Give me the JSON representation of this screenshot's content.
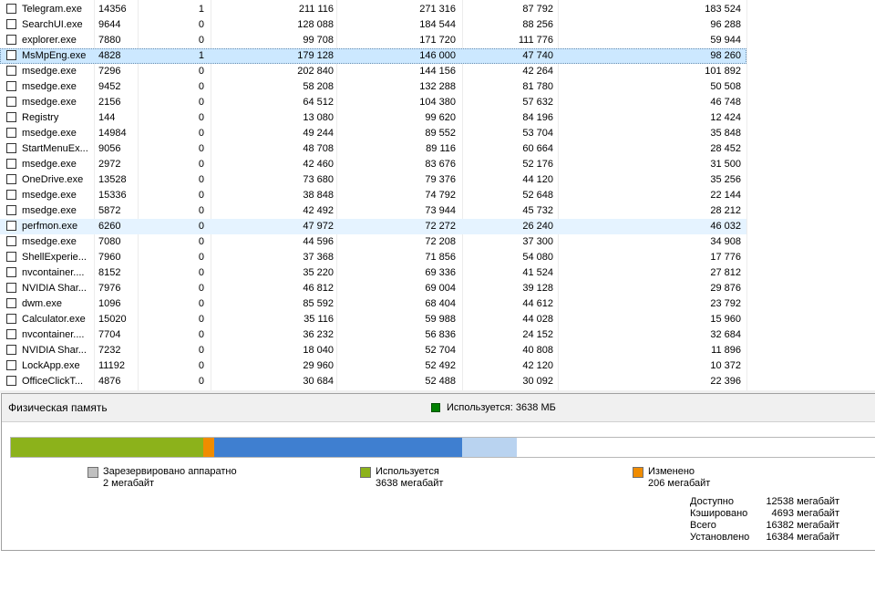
{
  "processes": [
    {
      "name": "Telegram.exe",
      "pid": "14356",
      "a": "1",
      "b": "211 116",
      "c": "271 316",
      "d": "87 792",
      "e": "183 524"
    },
    {
      "name": "SearchUI.exe",
      "pid": "9644",
      "a": "0",
      "b": "128 088",
      "c": "184 544",
      "d": "88 256",
      "e": "96 288"
    },
    {
      "name": "explorer.exe",
      "pid": "7880",
      "a": "0",
      "b": "99 708",
      "c": "171 720",
      "d": "111 776",
      "e": "59 944"
    },
    {
      "name": "MsMpEng.exe",
      "pid": "4828",
      "a": "1",
      "b": "179 128",
      "c": "146 000",
      "d": "47 740",
      "e": "98 260",
      "state": "selected"
    },
    {
      "name": "msedge.exe",
      "pid": "7296",
      "a": "0",
      "b": "202 840",
      "c": "144 156",
      "d": "42 264",
      "e": "101 892"
    },
    {
      "name": "msedge.exe",
      "pid": "9452",
      "a": "0",
      "b": "58 208",
      "c": "132 288",
      "d": "81 780",
      "e": "50 508"
    },
    {
      "name": "msedge.exe",
      "pid": "2156",
      "a": "0",
      "b": "64 512",
      "c": "104 380",
      "d": "57 632",
      "e": "46 748"
    },
    {
      "name": "Registry",
      "pid": "144",
      "a": "0",
      "b": "13 080",
      "c": "99 620",
      "d": "84 196",
      "e": "12 424"
    },
    {
      "name": "msedge.exe",
      "pid": "14984",
      "a": "0",
      "b": "49 244",
      "c": "89 552",
      "d": "53 704",
      "e": "35 848"
    },
    {
      "name": "StartMenuEx...",
      "pid": "9056",
      "a": "0",
      "b": "48 708",
      "c": "89 116",
      "d": "60 664",
      "e": "28 452"
    },
    {
      "name": "msedge.exe",
      "pid": "2972",
      "a": "0",
      "b": "42 460",
      "c": "83 676",
      "d": "52 176",
      "e": "31 500"
    },
    {
      "name": "OneDrive.exe",
      "pid": "13528",
      "a": "0",
      "b": "73 680",
      "c": "79 376",
      "d": "44 120",
      "e": "35 256"
    },
    {
      "name": "msedge.exe",
      "pid": "15336",
      "a": "0",
      "b": "38 848",
      "c": "74 792",
      "d": "52 648",
      "e": "22 144"
    },
    {
      "name": "msedge.exe",
      "pid": "5872",
      "a": "0",
      "b": "42 492",
      "c": "73 944",
      "d": "45 732",
      "e": "28 212"
    },
    {
      "name": "perfmon.exe",
      "pid": "6260",
      "a": "0",
      "b": "47 972",
      "c": "72 272",
      "d": "26 240",
      "e": "46 032",
      "state": "hover"
    },
    {
      "name": "msedge.exe",
      "pid": "7080",
      "a": "0",
      "b": "44 596",
      "c": "72 208",
      "d": "37 300",
      "e": "34 908"
    },
    {
      "name": "ShellExperie...",
      "pid": "7960",
      "a": "0",
      "b": "37 368",
      "c": "71 856",
      "d": "54 080",
      "e": "17 776"
    },
    {
      "name": "nvcontainer....",
      "pid": "8152",
      "a": "0",
      "b": "35 220",
      "c": "69 336",
      "d": "41 524",
      "e": "27 812"
    },
    {
      "name": "NVIDIA Shar...",
      "pid": "7976",
      "a": "0",
      "b": "46 812",
      "c": "69 004",
      "d": "39 128",
      "e": "29 876"
    },
    {
      "name": "dwm.exe",
      "pid": "1096",
      "a": "0",
      "b": "85 592",
      "c": "68 404",
      "d": "44 612",
      "e": "23 792"
    },
    {
      "name": "Calculator.exe",
      "pid": "15020",
      "a": "0",
      "b": "35 116",
      "c": "59 988",
      "d": "44 028",
      "e": "15 960"
    },
    {
      "name": "nvcontainer....",
      "pid": "7704",
      "a": "0",
      "b": "36 232",
      "c": "56 836",
      "d": "24 152",
      "e": "32 684"
    },
    {
      "name": "NVIDIA Shar...",
      "pid": "7232",
      "a": "0",
      "b": "18 040",
      "c": "52 704",
      "d": "40 808",
      "e": "11 896"
    },
    {
      "name": "LockApp.exe",
      "pid": "11192",
      "a": "0",
      "b": "29 960",
      "c": "52 492",
      "d": "42 120",
      "e": "10 372"
    },
    {
      "name": "OfficeClickT...",
      "pid": "4876",
      "a": "0",
      "b": "30 684",
      "c": "52 488",
      "d": "30 092",
      "e": "22 396"
    }
  ],
  "memory": {
    "title": "Физическая память",
    "summary": "Используется: 3638 МБ",
    "bar_total_mb": 16384,
    "bar_segments": [
      {
        "key": "used",
        "mb": 3638,
        "color": "#8cb21b"
      },
      {
        "key": "modified",
        "mb": 206,
        "color": "#f08c00"
      },
      {
        "key": "standby",
        "mb": 4693,
        "color": "#3f7fd0"
      },
      {
        "key": "free",
        "mb": 1030,
        "color": "#b9d3f0"
      }
    ],
    "legend": {
      "reserved": {
        "label": "Зарезервировано аппаратно",
        "value": "2 мегабайт",
        "color": "#c0c0c0"
      },
      "used": {
        "label": "Используется",
        "value": "3638 мегабайт",
        "color": "#8cb21b"
      },
      "modified": {
        "label": "Изменено",
        "value": "206 мегабайт",
        "color": "#f08c00"
      }
    },
    "stats": [
      {
        "label": "Доступно",
        "value": "12538 мегабайт"
      },
      {
        "label": "Кэшировано",
        "value": "4693 мегабайт"
      },
      {
        "label": "Всего",
        "value": "16382 мегабайт"
      },
      {
        "label": "Установлено",
        "value": "16384 мегабайт"
      }
    ],
    "summary_color": "#008000"
  }
}
